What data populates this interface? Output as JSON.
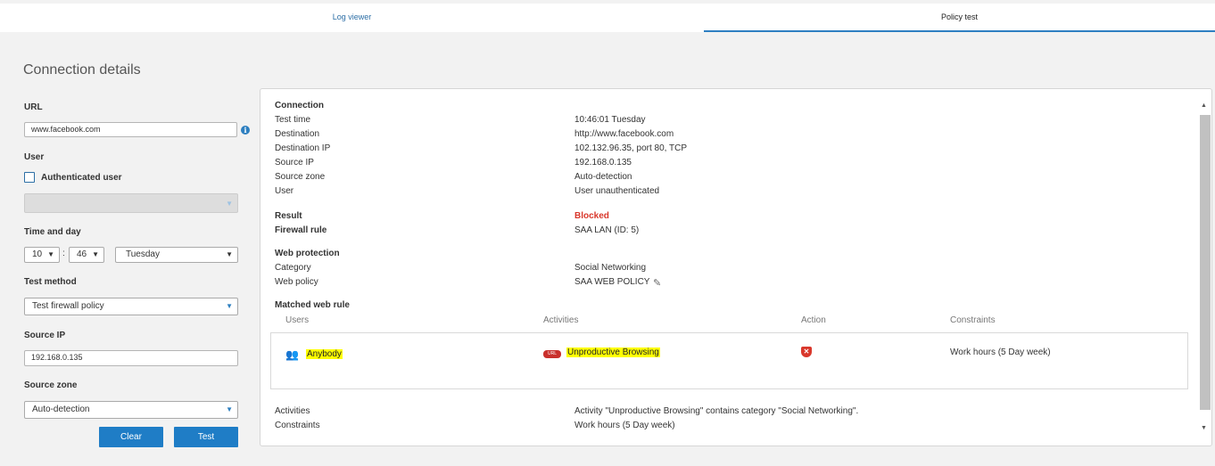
{
  "tabs": [
    {
      "label": "Log viewer"
    },
    {
      "label": "Policy test"
    }
  ],
  "form": {
    "heading": "Connection details",
    "url_label": "URL",
    "url_value": "www.facebook.com",
    "user_label": "User",
    "auth_label": "Authenticated user",
    "time_label": "Time and day",
    "hour": "10",
    "minute": "46",
    "separator": ":",
    "day": "Tuesday",
    "method_label": "Test method",
    "method_value": "Test firewall policy",
    "source_ip_label": "Source IP",
    "source_ip_value": "192.168.0.135",
    "zone_label": "Source zone",
    "zone_value": "Auto-detection",
    "clear": "Clear",
    "test": "Test"
  },
  "result": {
    "connection_heading": "Connection",
    "rows": [
      {
        "label": "Test time",
        "value": "10:46:01 Tuesday"
      },
      {
        "label": "Destination",
        "value": "http://www.facebook.com"
      },
      {
        "label": "Destination IP",
        "value": "102.132.96.35, port 80, TCP"
      },
      {
        "label": "Source IP",
        "value": "192.168.0.135"
      },
      {
        "label": "Source zone",
        "value": "Auto-detection"
      },
      {
        "label": "User",
        "value": "User unauthenticated"
      }
    ],
    "result_label": "Result",
    "result_value": "Blocked",
    "fw_label": "Firewall rule",
    "fw_value": "SAA LAN (ID: 5)",
    "webprot_heading": "Web protection",
    "category_label": "Category",
    "category_value": "Social Networking",
    "webpolicy_label": "Web policy",
    "webpolicy_value": "SAA WEB POLICY",
    "matched_heading": "Matched web rule",
    "columns": [
      "Users",
      "Activities",
      "Action",
      "Constraints"
    ],
    "rule": {
      "users": "Anybody",
      "activity": "Unproductive Browsing",
      "app_icon_text": "URL",
      "constraints": "Work hours (5 Day week)"
    },
    "activities_label": "Activities",
    "activities_value": "Activity \"Unproductive Browsing\" contains category \"Social Networking\".",
    "constraints_label": "Constraints",
    "constraints_value": "Work hours (5 Day week)"
  },
  "colors": {
    "accent": "#1f7dc6",
    "blocked": "#d9372b",
    "highlight": "#ffff00"
  }
}
